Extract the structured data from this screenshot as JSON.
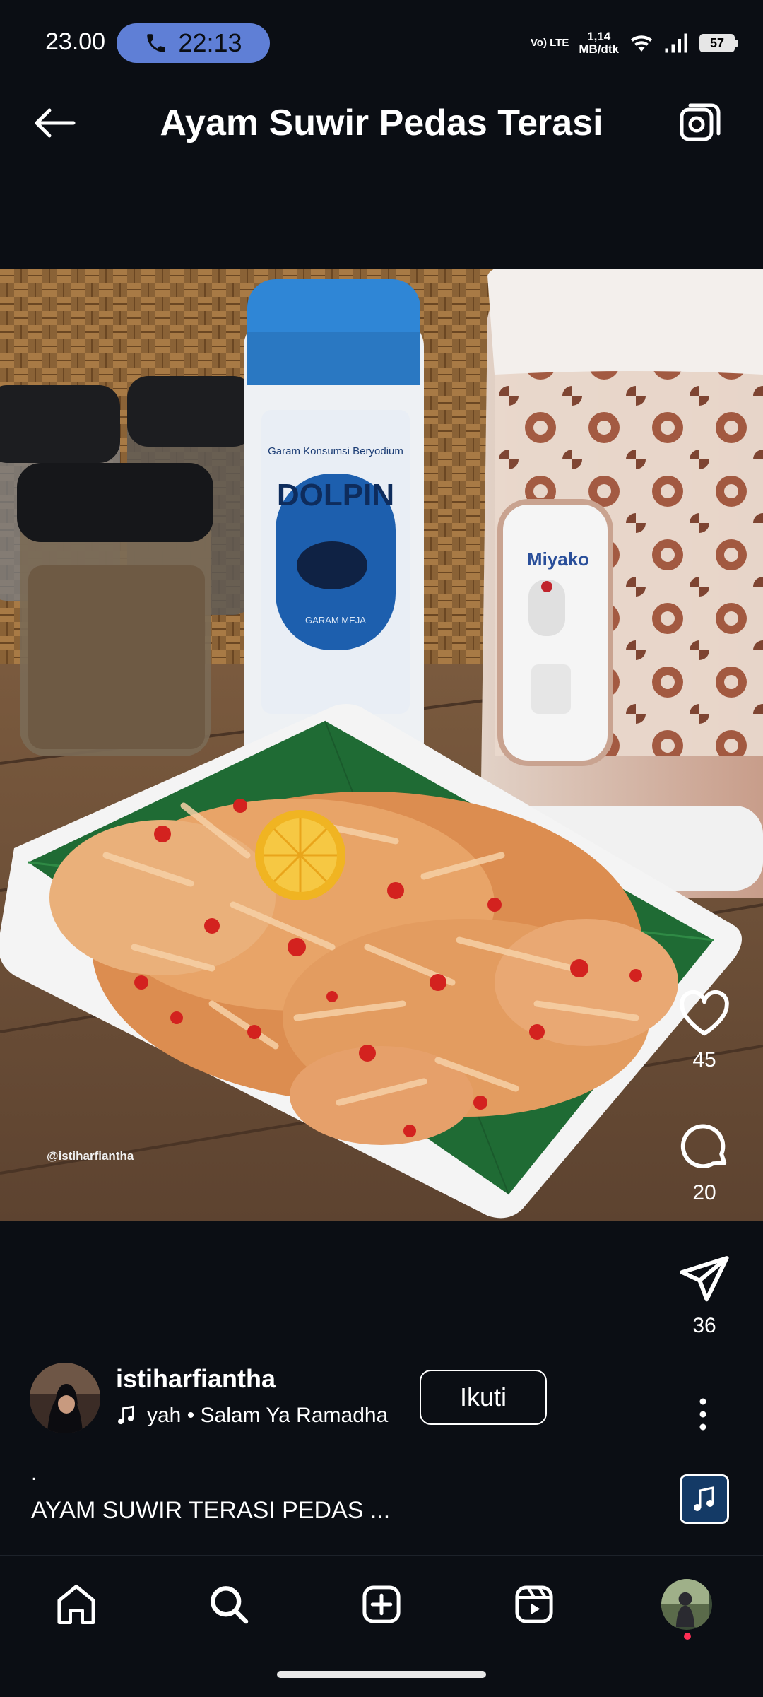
{
  "status_bar": {
    "time": "23.00",
    "call_duration": "22:13",
    "network_label": "Vo) LTE",
    "speed_value": "1,14",
    "speed_unit": "MB/dtk",
    "battery": "57"
  },
  "header": {
    "title": "Ayam Suwir Pedas Terasi",
    "back_icon": "arrow-left-icon",
    "camera_icon": "camera-icon"
  },
  "media": {
    "watermark": "@istiharfiantha",
    "jar_label_line1": "Garam Konsumsi Beryodium",
    "jar_brand": "DOLPIN",
    "jar_label_line2": "GARAM MEJA",
    "cooker_brand": "Miyako"
  },
  "actions": {
    "likes": "45",
    "comments": "20",
    "shares": "36"
  },
  "author": {
    "username": "istiharfiantha",
    "audio_text": "yah • Salam Ya Ramadha",
    "follow_label": "Ikuti"
  },
  "caption": {
    "dot": ".",
    "text": "AYAM SUWIR TERASI PEDAS ..."
  },
  "colors": {
    "background": "#0b0e14",
    "call_pill": "#5f7fd6",
    "notification": "#ff2e55"
  },
  "nav": {
    "icons": [
      "home-icon",
      "search-icon",
      "create-icon",
      "reels-icon",
      "profile-avatar"
    ]
  }
}
